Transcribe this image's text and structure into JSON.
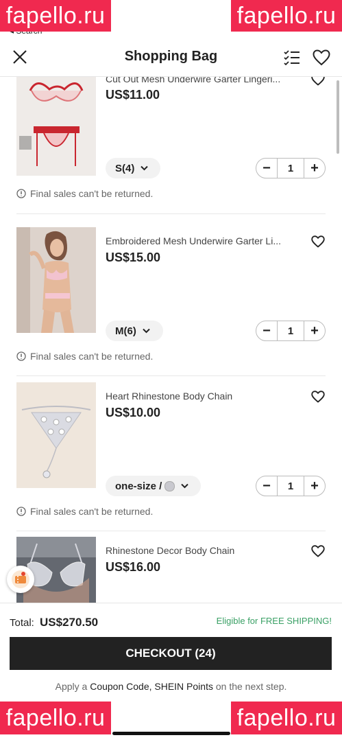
{
  "status": {
    "back_label": "◂ Search"
  },
  "watermark": {
    "text": "fapello.ru"
  },
  "header": {
    "title": "Shopping Bag"
  },
  "items": [
    {
      "name": "Cut Out Mesh Underwire Garter Lingeri...",
      "price": "US$11.00",
      "size": "S(4)",
      "qty": "1",
      "note": "Final sales can't be returned."
    },
    {
      "name": "Embroidered Mesh Underwire Garter Li...",
      "price": "US$15.00",
      "size": "M(6)",
      "qty": "1",
      "note": "Final sales can't be returned."
    },
    {
      "name": "Heart Rhinestone Body Chain",
      "price": "US$10.00",
      "size": "one-size / ",
      "qty": "1",
      "note": "Final sales can't be returned."
    },
    {
      "name": "Rhinestone Decor Body Chain",
      "price": "US$16.00"
    }
  ],
  "footer": {
    "total_label": "Total:",
    "total_value": "US$270.50",
    "free_shipping": "Eligible for FREE SHIPPING!",
    "checkout_label": "CHECKOUT (24)",
    "apply_prefix": "Apply a ",
    "apply_links": "Coupon Code, SHEIN Points",
    "apply_suffix": " on the next step."
  },
  "stepper": {
    "minus": "−",
    "plus": "+"
  },
  "icons": [
    "close-icon",
    "checklist-icon",
    "heart-icon",
    "chevron-down-icon",
    "info-icon",
    "coupon-icon"
  ],
  "colors": {
    "accent": "#222222",
    "free_shipping": "#3aa065",
    "watermark": "#f0294f"
  }
}
